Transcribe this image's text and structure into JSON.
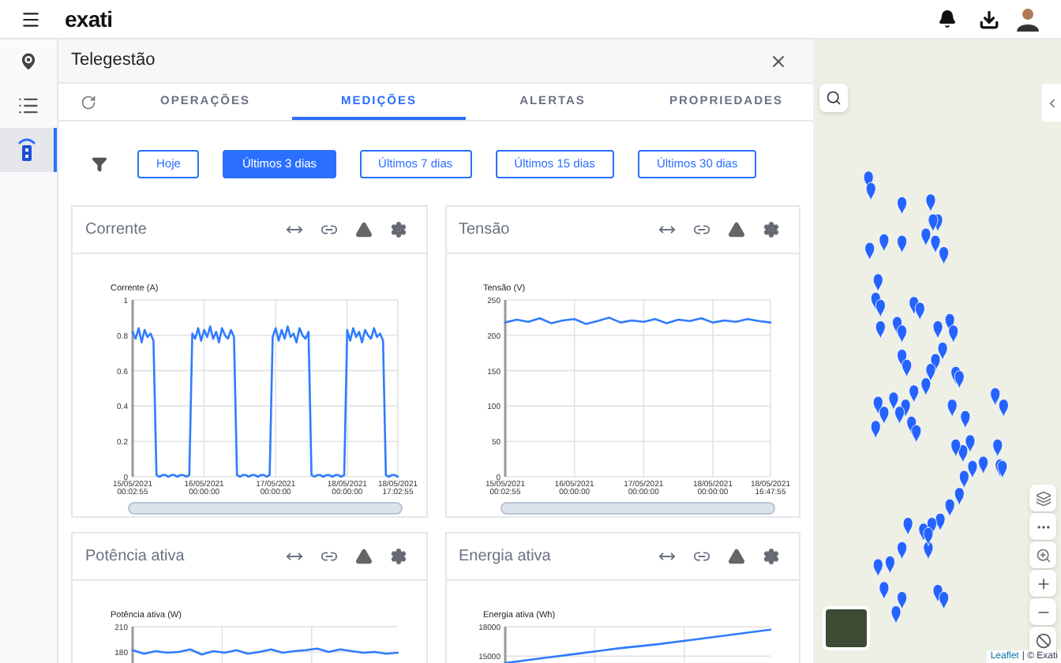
{
  "topbar": {
    "logo": "exati"
  },
  "sidebar": {
    "items": [
      {
        "kind": "pin",
        "selected": false
      },
      {
        "kind": "list",
        "selected": false
      },
      {
        "kind": "device",
        "selected": true
      }
    ]
  },
  "panel": {
    "title": "Telegestão",
    "tabs": [
      {
        "label": "OPERAÇÕES",
        "selected": false
      },
      {
        "label": "MEDIÇÕES",
        "selected": true
      },
      {
        "label": "ALERTAS",
        "selected": false
      },
      {
        "label": "PROPRIEDADES",
        "selected": false
      }
    ],
    "filters": [
      {
        "label": "Hoje",
        "selected": false
      },
      {
        "label": "Últimos 3 dias",
        "selected": true
      },
      {
        "label": "Últimos 7 dias",
        "selected": false
      },
      {
        "label": "Últimos 15 dias",
        "selected": false
      },
      {
        "label": "Últimos 30 dias",
        "selected": false
      }
    ],
    "cards": [
      {
        "title": "Corrente",
        "chart_data": {
          "type": "line",
          "grid": true,
          "ylabel": "Corrente (A)",
          "ylim": [
            0,
            1
          ],
          "yticks": [
            0,
            0.2,
            0.4,
            0.6,
            0.8,
            1
          ],
          "categories": [
            "15/05/2021\n00:02:55",
            null,
            null,
            null,
            null,
            null,
            null,
            null,
            null,
            null,
            null,
            null,
            null,
            null,
            null,
            null,
            null,
            null,
            null,
            null,
            null,
            null,
            null,
            null,
            "16/05/2021\n00:00:00",
            null,
            null,
            null,
            null,
            null,
            null,
            null,
            null,
            null,
            null,
            null,
            null,
            null,
            null,
            null,
            null,
            null,
            null,
            null,
            null,
            null,
            null,
            null,
            "17/05/2021\n00:00:00",
            null,
            null,
            null,
            null,
            null,
            null,
            null,
            null,
            null,
            null,
            null,
            null,
            null,
            null,
            null,
            null,
            null,
            null,
            null,
            null,
            null,
            null,
            null,
            "18/05/2021\n00:00:00",
            null,
            null,
            null,
            null,
            null,
            null,
            null,
            null,
            null,
            null,
            null,
            null,
            null,
            null,
            null,
            null,
            "18/05/2021\n17:02:55"
          ],
          "series": [
            {
              "color": "#2f7bff",
              "values": [
                0.82,
                0.78,
                0.84,
                0.76,
                0.83,
                0.79,
                0.81,
                0.77,
                0.01,
                0,
                0.01,
                0.01,
                0,
                0.01,
                0.01,
                0,
                0.01,
                0.01,
                0,
                0.01,
                0.81,
                0.78,
                0.84,
                0.77,
                0.83,
                0.79,
                0.85,
                0.78,
                0.82,
                0.76,
                0.84,
                0.8,
                0.78,
                0.83,
                0.79,
                0.01,
                0,
                0.01,
                0.01,
                0,
                0.01,
                0.01,
                0,
                0.01,
                0.01,
                0,
                0.01,
                0.79,
                0.84,
                0.77,
                0.83,
                0.78,
                0.85,
                0.79,
                0.81,
                0.76,
                0.84,
                0.8,
                0.78,
                0.82,
                0.01,
                0,
                0.01,
                0.01,
                0,
                0.01,
                0.01,
                0,
                0.01,
                0.01,
                0,
                0.01,
                0.83,
                0.77,
                0.84,
                0.79,
                0.82,
                0.76,
                0.83,
                0.8,
                0.78,
                0.84,
                0.79,
                0.81,
                0.77,
                0.01,
                0,
                0.01,
                0.01,
                0
              ]
            }
          ]
        }
      },
      {
        "title": "Tensão",
        "chart_data": {
          "type": "line",
          "grid": true,
          "ylabel": "Tensão (V)",
          "ylim": [
            0,
            250
          ],
          "yticks": [
            0,
            50,
            100,
            150,
            200,
            250
          ],
          "categories": [
            "15/05/2021\n00:02:55",
            null,
            null,
            null,
            null,
            null,
            "16/05/2021\n00:00:00",
            null,
            null,
            null,
            null,
            null,
            "17/05/2021\n00:00:00",
            null,
            null,
            null,
            null,
            null,
            "18/05/2021\n00:00:00",
            null,
            null,
            null,
            null,
            "18/05/2021\n16:47:55"
          ],
          "series": [
            {
              "color": "#2f7bff",
              "values": [
                218,
                222,
                219,
                224,
                217,
                221,
                223,
                216,
                220,
                225,
                218,
                221,
                219,
                223,
                217,
                222,
                220,
                224,
                218,
                221,
                219,
                223,
                220,
                218
              ]
            }
          ]
        }
      },
      {
        "title": "Potência ativa",
        "chart_data": {
          "type": "line",
          "grid": true,
          "ylabel": "Potência ativa (W)",
          "ylim": [
            0,
            210
          ],
          "yticks": [
            180,
            210
          ],
          "categories": [
            null,
            null,
            null,
            null,
            null,
            null,
            null,
            null,
            null,
            null,
            null,
            null,
            null,
            null,
            null,
            null,
            null,
            null,
            null,
            null,
            null,
            null,
            null,
            null
          ],
          "series": [
            {
              "color": "#2f7bff",
              "values": [
                182,
                178,
                181,
                179,
                180,
                183,
                177,
                181,
                179,
                182,
                178,
                180,
                183,
                179,
                181,
                182,
                184,
                180,
                183,
                181,
                179,
                180,
                178,
                179
              ]
            }
          ]
        }
      },
      {
        "title": "Energia ativa",
        "chart_data": {
          "type": "line",
          "ylabel": "Energia ativa (Wh)",
          "ylim": [
            0,
            18000
          ],
          "yticks": [
            15000,
            18000
          ],
          "grid": true,
          "categories": [
            null,
            null,
            null,
            null,
            null,
            null,
            null,
            null
          ],
          "series": [
            {
              "color": "#2f7bff",
              "values": [
                14300,
                14800,
                15300,
                15800,
                16200,
                16700,
                17200,
                17700
              ]
            }
          ]
        }
      }
    ]
  },
  "map": {
    "attribution_link": "Leaflet",
    "attribution_text": "| © Exati"
  }
}
